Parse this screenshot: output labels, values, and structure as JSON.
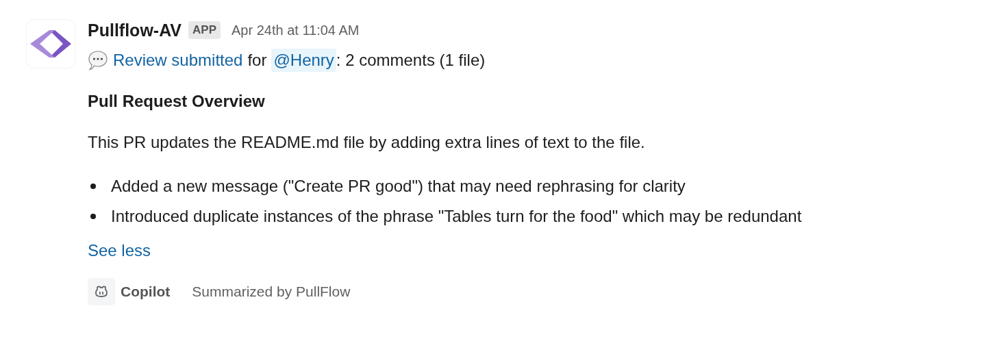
{
  "message": {
    "sender": "Pullflow-AV",
    "badge": "APP",
    "time": "Apr 24th at 11:04 AM",
    "summary": {
      "link": "Review submitted",
      "middle": "for",
      "mention": "@Henry",
      "rest": ": 2 comments (1 file)"
    },
    "heading": "Pull Request Overview",
    "paragraph": "This PR updates the README.md file by adding extra lines of text to the file.",
    "bullets": [
      "Added a new message (\"Create PR good\") that may need rephrasing for clarity",
      "Introduced duplicate instances of the phrase \"Tables turn for the food\" which may be redundant"
    ],
    "toggle": "See less",
    "footer": {
      "bot": "Copilot",
      "note": "Summarized by PullFlow"
    }
  }
}
